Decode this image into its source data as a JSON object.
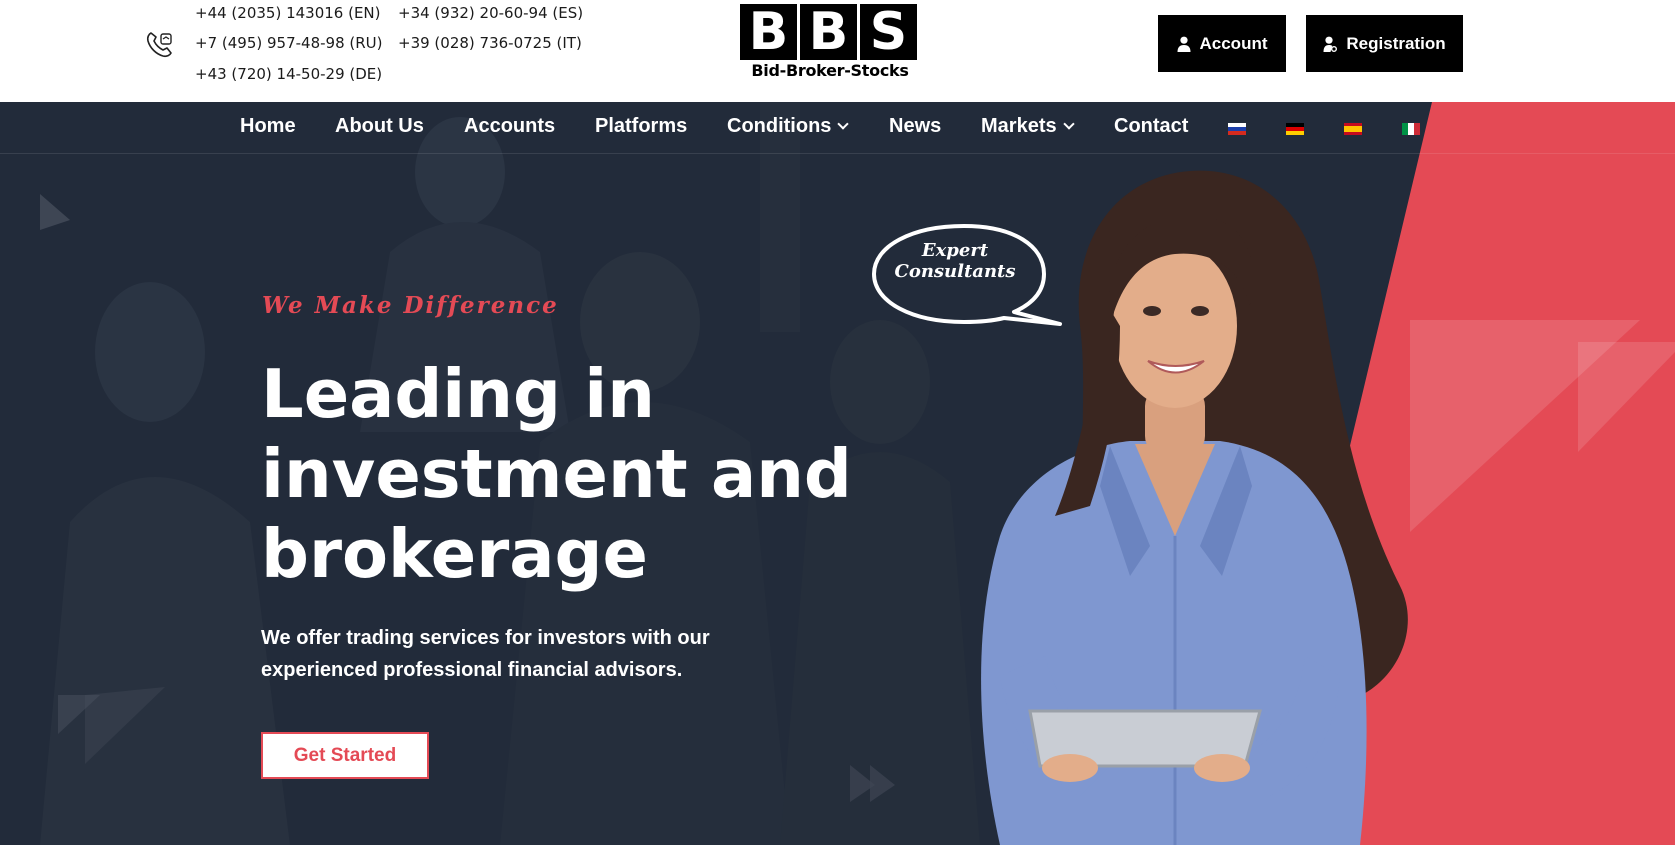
{
  "header": {
    "phones": [
      "+44 (2035) 143016 (EN)",
      "+34 (932) 20-60-94 (ES)",
      "+7 (495) 957-48-98 (RU)",
      "+39 (028) 736-0725 (IT)",
      "+43 (720) 14-50-29 (DE)"
    ],
    "logo": {
      "letters": [
        "B",
        "B",
        "S"
      ],
      "subtitle": "Bid-Broker-Stocks"
    },
    "account_label": "Account",
    "registration_label": "Registration"
  },
  "nav": {
    "items": [
      {
        "label": "Home"
      },
      {
        "label": "About Us"
      },
      {
        "label": "Accounts"
      },
      {
        "label": "Platforms"
      },
      {
        "label": "Conditions",
        "dropdown": true
      },
      {
        "label": "News"
      },
      {
        "label": "Markets",
        "dropdown": true
      },
      {
        "label": "Contact"
      }
    ],
    "flags": [
      "ru",
      "de",
      "es",
      "it"
    ]
  },
  "hero": {
    "tagline": "We Make Difference",
    "headline": "Leading in investment and brokerage",
    "subtext": "We offer trading services for investors with our experienced professional financial advisors.",
    "cta_label": "Get Started",
    "bubble": {
      "line1": "Expert",
      "line2": "Consultants"
    }
  },
  "colors": {
    "accent": "#e44a55",
    "hero_bg": "#222b3a",
    "button_bg": "#000000"
  },
  "icons": [
    "phone-icon",
    "user-icon",
    "user-settings-icon",
    "chevron-down-icon"
  ]
}
